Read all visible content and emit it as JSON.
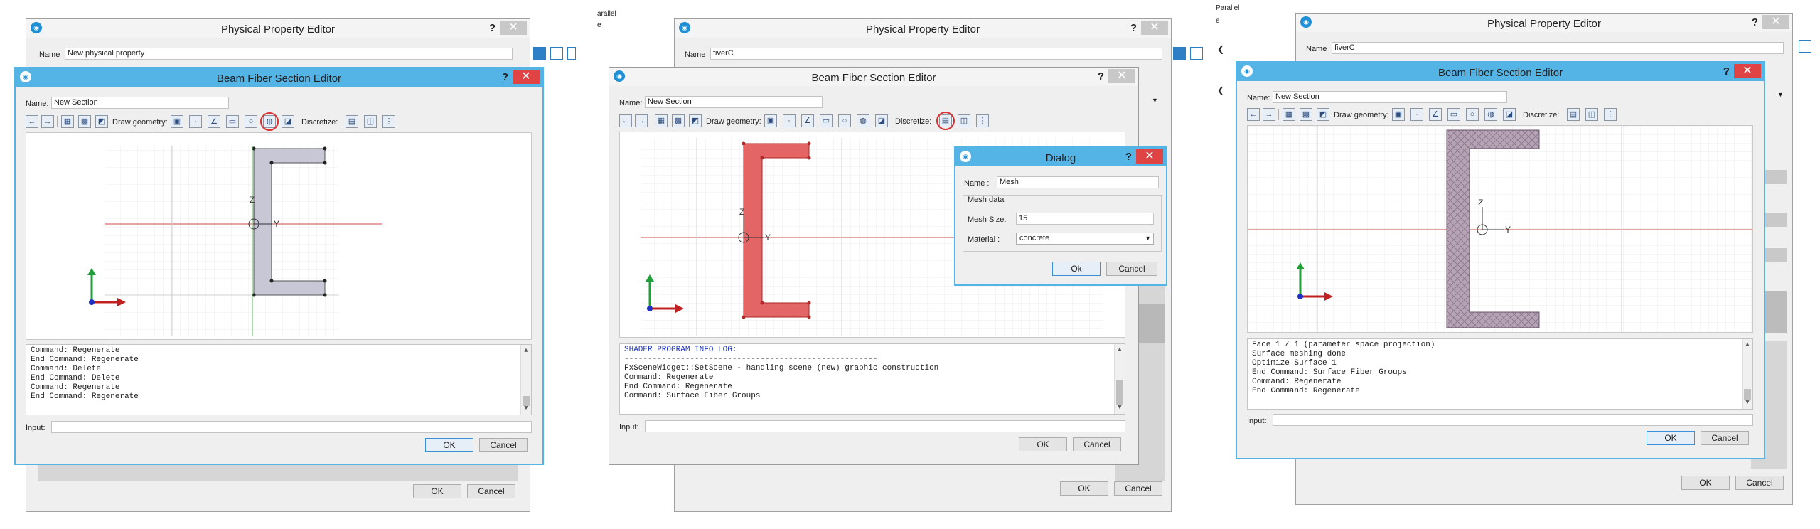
{
  "colors": {
    "accent": "#55b4e6",
    "close_active": "#e04343",
    "section_fill_1": "#c7c7d6",
    "section_fill_2": "#e46565",
    "section_fill_3": "#b6a4b6",
    "highlight": "#d93030",
    "axis_green": "#1fa03b",
    "axis_red": "#c02020",
    "axis_blue": "#2030c0"
  },
  "icons": [
    "app-icon",
    "help-icon",
    "close-icon",
    "arrow-left-icon",
    "arrow-right-icon",
    "grid-icon",
    "grid-bold-icon",
    "snap-icon",
    "rectangle-icon",
    "point-icon",
    "line-icon",
    "rect-icon",
    "circle-icon",
    "surface-icon",
    "polygon-icon",
    "discretize-icon",
    "split-icon",
    "fiber-icon"
  ],
  "shared": {
    "ppe_title": "Physical Property Editor",
    "bfse_title": "Beam Fiber Section Editor",
    "help": "?",
    "close": "✕",
    "name_label": "Name",
    "name_label_colon": "Name:",
    "draw_geometry": "Draw geometry:",
    "discretize": "Discretize:",
    "input_label": "Input:",
    "ok": "OK",
    "cancel": "Cancel",
    "ok_alt": "Ok",
    "section_name": "New Section",
    "axis_z": "Z",
    "axis_y": "Y"
  },
  "panel1": {
    "ppe_name_value": "New physical property",
    "log": [
      "Command: Regenerate",
      "End Command: Regenerate",
      "Command: Delete",
      "End Command: Delete",
      "Command: Regenerate",
      "End Command: Regenerate"
    ]
  },
  "panel2": {
    "corner_text": "arallel",
    "corner_text2": "e",
    "ppe_name_value": "fiverC",
    "log_header": "SHADER PROGRAM INFO LOG:",
    "log_rule": "------------------------------------------------------",
    "log": [
      "FxSceneWidget::SetScene - handling scene (new) graphic construction",
      "Command: Regenerate",
      "End Command: Regenerate",
      "Command: Surface Fiber Groups"
    ],
    "dialog": {
      "title": "Dialog",
      "name_label": "Name :",
      "name_value": "Mesh",
      "group_label": "Mesh data",
      "mesh_size_label": "Mesh Size:",
      "mesh_size_value": "15",
      "material_label": "Material :",
      "material_value": "concrete",
      "ok": "Ok",
      "cancel": "Cancel"
    }
  },
  "panel3": {
    "corner_text": "Parallel",
    "corner_text2": "e",
    "ppe_name_value": "fiverC",
    "log": [
      "Face 1 / 1 (parameter space projection)",
      "Surface meshing done",
      "Optimize Surface 1",
      "End Command: Surface Fiber Groups",
      "Command: Regenerate",
      "End Command: Regenerate"
    ]
  }
}
